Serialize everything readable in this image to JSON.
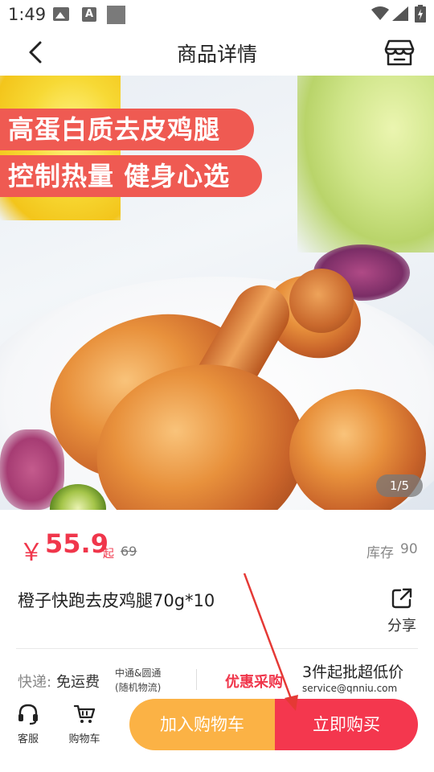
{
  "status_bar": {
    "time": "1:49",
    "icons": [
      "photo-icon",
      "a-icon",
      "square-icon",
      "wifi-icon",
      "signal-icon",
      "battery-icon"
    ]
  },
  "header": {
    "title": "商品详情",
    "back_icon": "chevron-left-icon",
    "shop_icon": "store-icon"
  },
  "product_image": {
    "banner_line1": "高蛋白质去皮鸡腿",
    "banner_line2": "控制热量 健身心选",
    "counter": "1/5"
  },
  "price": {
    "symbol": "￥",
    "value": "55.9",
    "unit": "起",
    "original": "69",
    "stock_label": "库存",
    "stock_value": "90"
  },
  "product": {
    "name": "橙子快跑去皮鸡腿70g*10",
    "share_label": "分享"
  },
  "shipping": {
    "label": "快递:",
    "value": "免运费",
    "carriers": "中通&圆通",
    "carrier_note": "(随机物流)",
    "promo_label": "优惠采购",
    "bulk_text": "3件起批超低价",
    "service_email": "service@qnniu.com"
  },
  "bottom_bar": {
    "service_label": "客服",
    "cart_label": "购物车",
    "add_to_cart": "加入购物车",
    "buy_now": "立即购买"
  },
  "colors": {
    "price_red": "#f0364b",
    "banner_red": "#ef5a52",
    "add_cart_orange": "#fbb245",
    "buy_now_red": "#f4374e",
    "annotation_arrow": "#e53935"
  }
}
